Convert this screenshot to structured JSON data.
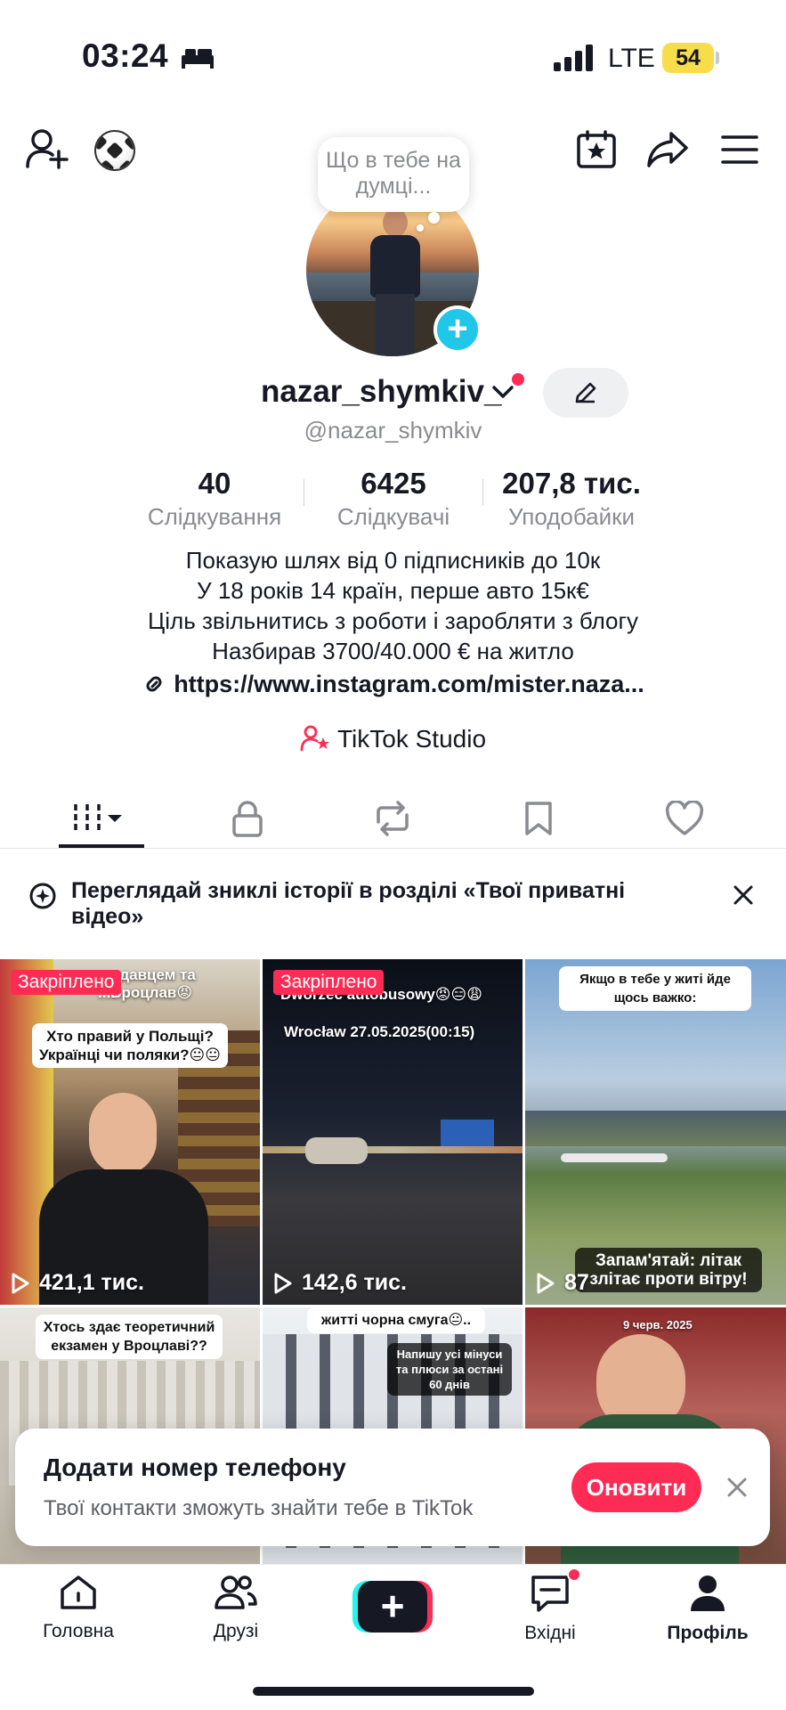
{
  "status_bar": {
    "time": "03:24",
    "network": "LTE",
    "battery": "54"
  },
  "profile": {
    "thought_bubble": "Що в тебе на думці...",
    "username": "nazar_shymkiv_",
    "handle": "@nazar_shymkiv"
  },
  "stats": [
    {
      "value": "40",
      "label": "Слідкування"
    },
    {
      "value": "6425",
      "label": "Слідкувачі"
    },
    {
      "value": "207,8 тис.",
      "label": "Уподобайки"
    }
  ],
  "bio": {
    "lines": [
      "Показую шлях від 0 підписників до 10к",
      "У 18 років 14 країн, перше авто 15к€",
      "Ціль звільнитись з роботи і заробляти з блогу",
      "Назбирав 3700/40.000 € на житло"
    ],
    "link": "https://www.instagram.com/mister.naza..."
  },
  "studio_label": "TikTok Studio",
  "banner": {
    "text": "Переглядай зниклі історії в розділі «Твої приватні відео»"
  },
  "videos": [
    {
      "pinned": "Закріплено",
      "views": "421,1 тис.",
      "overlay_top": "...одавцем та ...Вроцлав😡",
      "caption": "Хто правий у Польщі? Українці чи поляки?😐😐"
    },
    {
      "pinned": "Закріплено",
      "views": "142,6 тис.",
      "overlay_top": "Dworzec autobusowy😡😑😩",
      "caption": "Wrocław 27.05.2025(00:15)"
    },
    {
      "views": "87",
      "caption_top": "Якщо в тебе у житі йде щось важко:",
      "caption_bottom": "Запам'ятай: літак злітає проти вітру!"
    },
    {
      "caption": "Хтось здає теоретичний екзамен у Вроцлаві??"
    },
    {
      "caption_top": "житті чорна смуга😐..",
      "caption": "Напишу усі мінуси та плюси за остані 60 днів"
    },
    {
      "caption": "9 черв. 2025"
    }
  ],
  "phone_card": {
    "title": "Додати номер телефону",
    "subtitle": "Твої контакти зможуть знайти тебе в TikTok",
    "button": "Оновити"
  },
  "bottom_nav": [
    {
      "label": "Головна"
    },
    {
      "label": "Друзі"
    },
    {
      "label": "Вхідні"
    },
    {
      "label": "Профіль"
    }
  ],
  "colors": {
    "accent": "#fe2c55",
    "cyan": "#25f4ee",
    "text": "#161823",
    "muted": "#8a8b91"
  }
}
